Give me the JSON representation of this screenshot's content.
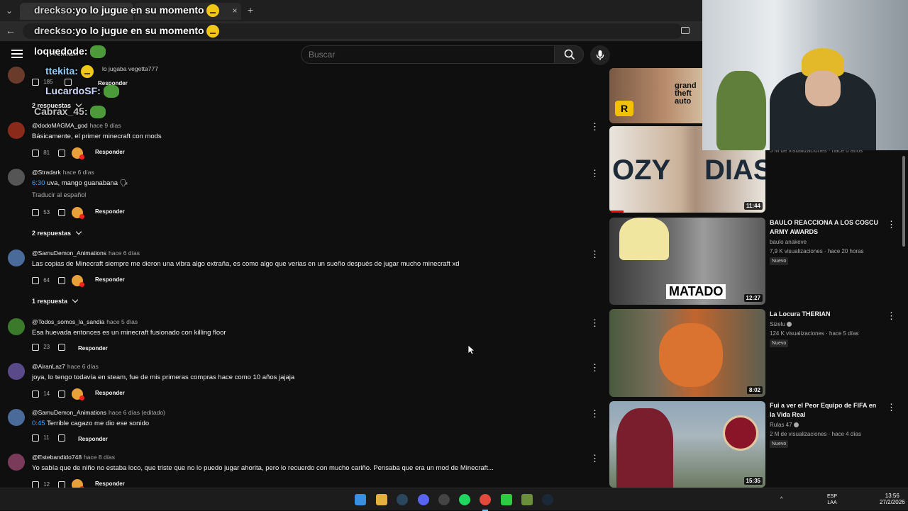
{
  "browser": {
    "tab_close": "×",
    "new_tab": "+"
  },
  "overlay_chat": [
    {
      "name": "drecksо:",
      "text": "yo lo jugue en su momento"
    },
    {
      "name": "drecksо:",
      "text": "yo lo jugue en su momento"
    },
    {
      "name": "loquedode:",
      "text": ""
    },
    {
      "name": "ttekita:",
      "text": ""
    },
    {
      "name": "LucardoSF:",
      "text": ""
    },
    {
      "name": "Cabrax_45:",
      "text": ""
    }
  ],
  "header": {
    "premium": "Premium",
    "search_placeholder": "Buscar"
  },
  "top_partial": {
    "text": "lo jugaba vegetta777",
    "likes": "185",
    "reply": "Responder",
    "replies": "2 respuestas"
  },
  "comments": [
    {
      "author": "@dodoMAGMA_god",
      "time": "hace 9 días",
      "ts": "",
      "text": "Básicamente, el primer minecraft con mods",
      "translate": "",
      "likes": "81",
      "reply": "Responder",
      "replies": "",
      "heart": true
    },
    {
      "author": "@Stradark",
      "time": "hace 6 días",
      "ts": "6:30",
      "text": " uva, mango guanabana 🗣",
      "translate": "Traducir al español",
      "likes": "53",
      "reply": "Responder",
      "replies": "2 respuestas",
      "heart": true
    },
    {
      "author": "@SamuDemon_Animations",
      "time": "hace 6 días",
      "ts": "",
      "text": "Las copias de Minecraft siempre me dieron una vibra algo extraña, es como algo que verias en un sueño después de jugar mucho minecraft xd",
      "translate": "",
      "likes": "64",
      "reply": "Responder",
      "replies": "1 respuesta",
      "heart": true
    },
    {
      "author": "@Todos_somos_la_sandia",
      "time": "hace 5 días",
      "ts": "",
      "text": "Esa huevada entonces es un minecraft fusionado con killing floor",
      "translate": "",
      "likes": "23",
      "reply": "Responder",
      "replies": "",
      "heart": false
    },
    {
      "author": "@AiranLaz7",
      "time": "hace 6 días",
      "ts": "",
      "text": "joya, lo tengo todavía en steam, fue de mis primeras compras hace como 10 años jajaja",
      "translate": "",
      "likes": "14",
      "reply": "Responder",
      "replies": "",
      "heart": true
    },
    {
      "author": "@SamuDemon_Animations",
      "time": "hace 6 días (editado)",
      "ts": "0:45",
      "text": " Terrible cagazo me dio ese sonido",
      "translate": "",
      "likes": "11",
      "reply": "Responder",
      "replies": "",
      "heart": false
    },
    {
      "author": "@Estebandido748",
      "time": "hace 8 días",
      "ts": "",
      "text": "Yo sabía que de niño no estaba loco, que triste que no lo puedo jugar ahorita, pero lo recuerdo con mucho cariño. Pensaba que era un mod de Minecraft...",
      "translate": "",
      "likes": "12",
      "reply": "Responder",
      "replies": "",
      "heart": true
    }
  ],
  "videos": [
    {
      "title": "",
      "channel": "",
      "meta": "3 M de visualizaciones · hace 6 años",
      "duration": "",
      "badge": ""
    },
    {
      "title": "",
      "channel": "",
      "meta": "",
      "duration": "11:44",
      "badge": ""
    },
    {
      "title": "BAULO REACCIONA A LOS COSCU ARMY AWARDS",
      "channel": "baulo anakeve",
      "meta": "7,9 K visualizaciones · hace 20 horas",
      "duration": "12:27",
      "badge": "Nuevo"
    },
    {
      "title": "La Locura THERIAN",
      "channel": "Sizelu",
      "meta": "124 K visualizaciones · hace 5 días",
      "duration": "8:02",
      "badge": "Nuevo"
    },
    {
      "title": "Fui a ver el Peor Equipo de FIFA en la Vida Real",
      "channel": "Rulas 47",
      "meta": "2 M de visualizaciones · hace 4 días",
      "duration": "15:35",
      "badge": "Nuevo"
    }
  ],
  "thumb_text": {
    "ozy": "OZY",
    "dias": "DIAS",
    "matado": "MATADO",
    "gta": "grand theft auto"
  },
  "taskbar": {
    "lang": "ESP",
    "lang2": "LAA",
    "time": "13:56",
    "date": "27/2/2026"
  }
}
